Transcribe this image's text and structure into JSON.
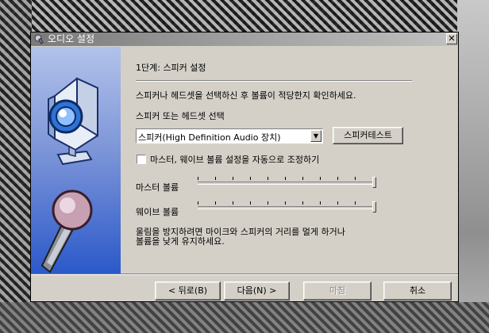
{
  "window": {
    "title": "오디오 설정",
    "close_glyph": "✕"
  },
  "wizard": {
    "step_title": "1단계: 스피커 설정",
    "instruction": "스피커나 헤드셋을 선택하신 후 볼륨이 적당한지 확인하세요.",
    "device_select_label": "스피커 또는 헤드셋 선택",
    "device_selected": "스피커(High Definition Audio 장치)",
    "speaker_test_button": "스피커테스트",
    "auto_adjust_checkbox": {
      "label": "마스터, 웨이브 볼륨 설정을 자동으로 조정하기",
      "checked": false
    },
    "master_volume": {
      "label": "마스터 볼륨",
      "level": 1.0
    },
    "wave_volume": {
      "label": "웨이브 볼륨",
      "level": 1.0
    },
    "advice_line1": "울림을 방지하려면 마이크와 스피커의 거리를 멀게 하거나",
    "advice_line2": "볼륨을 낮게 유지하세요."
  },
  "footer": {
    "back_label": "< 뒤로(B)",
    "next_label": "다음(N) >",
    "finish_label": "마침",
    "finish_enabled": false,
    "cancel_label": "취소"
  },
  "icons": {
    "title": "audio-settings-icon",
    "side_top": "webcam-icon",
    "side_bottom": "microphone-icon",
    "dropdown": "chevron-down-icon"
  },
  "colors": {
    "dialog_bg": "#d4d0c8",
    "side_panel_top": "#b2c2ea",
    "side_panel_bottom": "#2b59c9",
    "titlebar": "#7a7a7a"
  }
}
